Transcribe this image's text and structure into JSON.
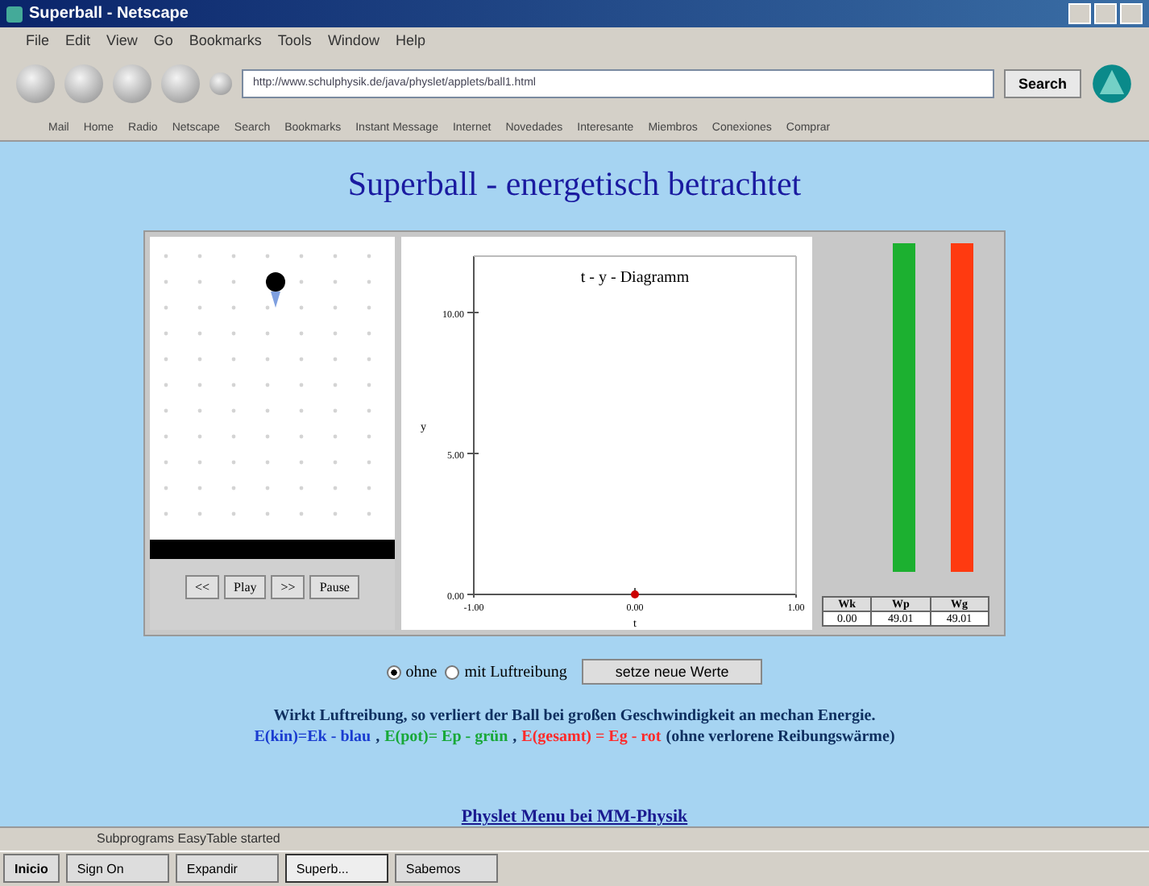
{
  "window": {
    "title": "Superball - Netscape"
  },
  "menu": [
    "File",
    "Edit",
    "View",
    "Go",
    "Bookmarks",
    "Tools",
    "Window",
    "Help"
  ],
  "address": {
    "value": "http://www.schulphysik.de/java/physlet/applets/ball1.html"
  },
  "search_button": "Search",
  "personal_toolbar": [
    "Mail",
    "Home",
    "Radio",
    "Netscape",
    "Search",
    "Bookmarks",
    "Instant Message",
    "Internet",
    "Novedades",
    "Interesante",
    "Miembros",
    "Conexiones",
    "Comprar"
  ],
  "page": {
    "heading": "Superball - energetisch betrachtet",
    "controls": [
      "<<",
      "Play",
      ">>",
      "Pause"
    ],
    "chart": {
      "chart_data": {
        "type": "scatter",
        "title": "t - y - Diagramm",
        "xlabel": "t",
        "ylabel": "y",
        "x": [
          0
        ],
        "series": [
          {
            "color": "#cc0000",
            "values": [
              0
            ]
          }
        ],
        "xlim": [
          -1,
          1
        ],
        "ylim": [
          0,
          12
        ],
        "xticks": [
          {
            "value": -1,
            "label": "-1.00"
          },
          {
            "value": 0,
            "label": "0.00"
          },
          {
            "value": 1,
            "label": "1.00"
          }
        ],
        "yticks": [
          {
            "value": 0,
            "label": "0.00"
          },
          {
            "value": 5,
            "label": "5.00"
          },
          {
            "value": 10,
            "label": "10.00"
          }
        ]
      }
    },
    "energy_bars": [
      {
        "level": 1,
        "color": "#1cb030"
      },
      {
        "level": 1,
        "color": "#ff3a10"
      }
    ],
    "energy_table": [
      {
        "label": "Wk",
        "value": "0.00"
      },
      {
        "label": "Wp",
        "value": "49.01"
      },
      {
        "label": "Wg",
        "value": "49.01"
      }
    ],
    "friction_options": [
      {
        "label": "ohne",
        "selected": true
      },
      {
        "label": "mit Luftreibung",
        "selected": false
      }
    ],
    "apply_button": "setze neue Werte",
    "note": "Wirkt Luftreibung, so verliert der Ball bei großen Geschwindigkeit an mechan Energie.",
    "legend": [
      {
        "text": "E(kin)=Ek - blau",
        "color": "#1a3cd0"
      },
      {
        "text": "E(pot)= Ep - grün",
        "color": "#18a838"
      },
      {
        "text": "E(gesamt) = Eg - rot",
        "color": "#ff2a2a"
      }
    ],
    "legend_separator": ",",
    "legend_suffix": "(ohne verlorene Reibungswärme)",
    "link": "Physlet Menu bei MM-Physik"
  },
  "status_bar": "Subprograms EasyTable started",
  "taskbar": {
    "start": "Inicio",
    "tasks": [
      {
        "label": "Sign On",
        "selected": false
      },
      {
        "label": "Expandir",
        "selected": false
      },
      {
        "label": "Superb...",
        "selected": true
      },
      {
        "label": "Sabemos",
        "selected": false
      }
    ]
  }
}
